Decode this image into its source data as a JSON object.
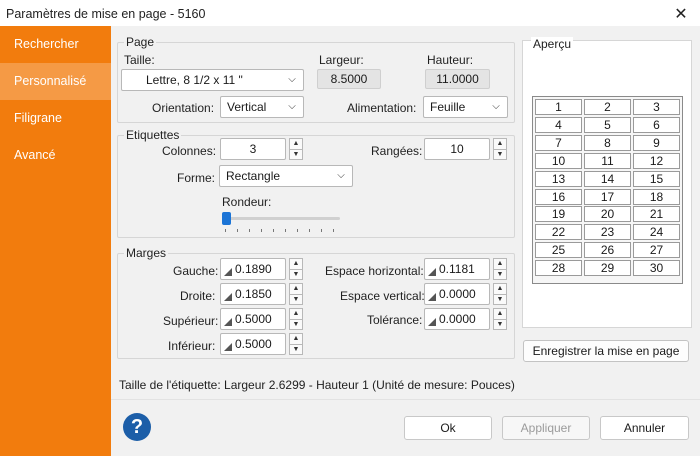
{
  "window": {
    "title": "Paramètres de mise en page - 5160",
    "close": "✕"
  },
  "sidebar": {
    "items": [
      {
        "label": "Rechercher"
      },
      {
        "label": "Personnalisé"
      },
      {
        "label": "Filigrane"
      },
      {
        "label": "Avancé"
      }
    ],
    "active_index": 1
  },
  "page": {
    "group_label": "Page",
    "size_label": "Taille:",
    "size_value": "Lettre, 8 1/2 x 11 \"",
    "width_label": "Largeur:",
    "width_value": "8.5000",
    "height_label": "Hauteur:",
    "height_value": "11.0000",
    "orientation_label": "Orientation:",
    "orientation_value": "Vertical",
    "feed_label": "Alimentation:",
    "feed_value": "Feuille"
  },
  "labels": {
    "group_label": "Etiquettes",
    "columns_label": "Colonnes:",
    "columns_value": "3",
    "rows_label": "Rangées:",
    "rows_value": "10",
    "shape_label": "Forme:",
    "shape_value": "Rectangle",
    "roundness_label": "Rondeur:",
    "roundness_level": 0
  },
  "margins": {
    "group_label": "Marges",
    "left_label": "Gauche:",
    "left_value": "0.1890",
    "right_label": "Droite:",
    "right_value": "0.1850",
    "top_label": "Supérieur:",
    "top_value": "0.5000",
    "bottom_label": "Inférieur:",
    "bottom_value": "0.5000",
    "hspace_label": "Espace horizontal:",
    "hspace_value": "0.1181",
    "vspace_label": "Espace vertical:",
    "vspace_value": "0.0000",
    "tolerance_label": "Tolérance:",
    "tolerance_value": "0.0000"
  },
  "preview": {
    "group_label": "Aperçu",
    "cells": [
      "1",
      "2",
      "3",
      "4",
      "5",
      "6",
      "7",
      "8",
      "9",
      "10",
      "11",
      "12",
      "13",
      "14",
      "15",
      "16",
      "17",
      "18",
      "19",
      "20",
      "21",
      "22",
      "23",
      "24",
      "25",
      "26",
      "27",
      "28",
      "29",
      "30"
    ],
    "save_button": "Enregistrer la mise en page"
  },
  "label_size_text": "Taille de l'étiquette: Largeur 2.6299 - Hauteur 1 (Unité de mesure: Pouces)",
  "footer": {
    "help_icon": "?",
    "ok": "Ok",
    "apply": "Appliquer",
    "cancel": "Annuler"
  },
  "icons": {
    "chevron": "⌵",
    "spin_up": "▲",
    "spin_down": "▼"
  },
  "colors": {
    "sidebar": "#f27c0d",
    "sidebar_active": "#f59a45",
    "help": "#1c5ea8",
    "slider": "#1b74d6"
  }
}
